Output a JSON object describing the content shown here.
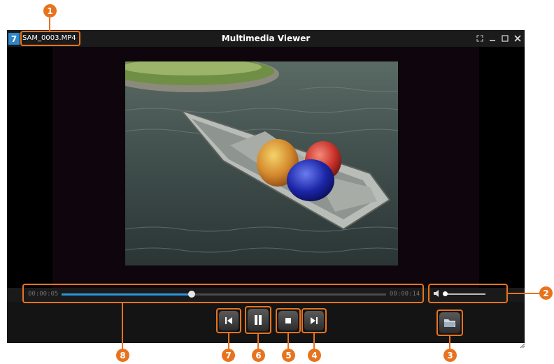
{
  "window": {
    "app_icon_glyph": "7",
    "file_name": "SAM_0003.MP4",
    "title": "Multimedia Viewer"
  },
  "player": {
    "elapsed": "00:00:05",
    "duration": "00:00:14",
    "progress_fraction": 0.4,
    "volume_fraction": 0.05
  },
  "callouts": [
    "1",
    "2",
    "3",
    "4",
    "5",
    "6",
    "7",
    "8"
  ],
  "colors": {
    "accent": "#e8731e",
    "progress": "#2e95d8",
    "titlebar": "#1b1b1b"
  }
}
